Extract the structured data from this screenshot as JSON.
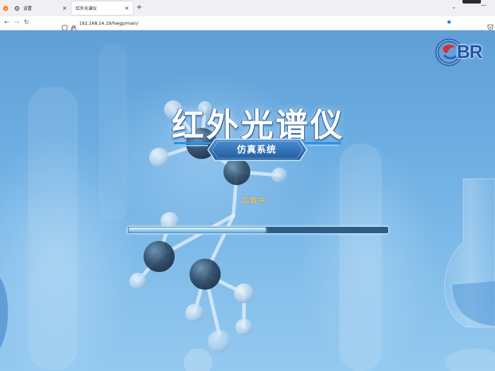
{
  "browser": {
    "tabs": [
      {
        "label": ""
      },
      {
        "label": "设置"
      },
      {
        "label": "红外光谱仪"
      }
    ],
    "url": "192.168.14.19/hwgp/main/"
  },
  "page": {
    "logo_text": "BR",
    "title": "红外光谱仪",
    "subtitle": "仿真系统",
    "loading_text": "加载中...",
    "progress_fraction": 0.53
  },
  "colors": {
    "accent": "#0060df",
    "loading": "#ffd35a",
    "logo": "#1d56a8",
    "subtitle_banner": "#2f6fb6"
  }
}
